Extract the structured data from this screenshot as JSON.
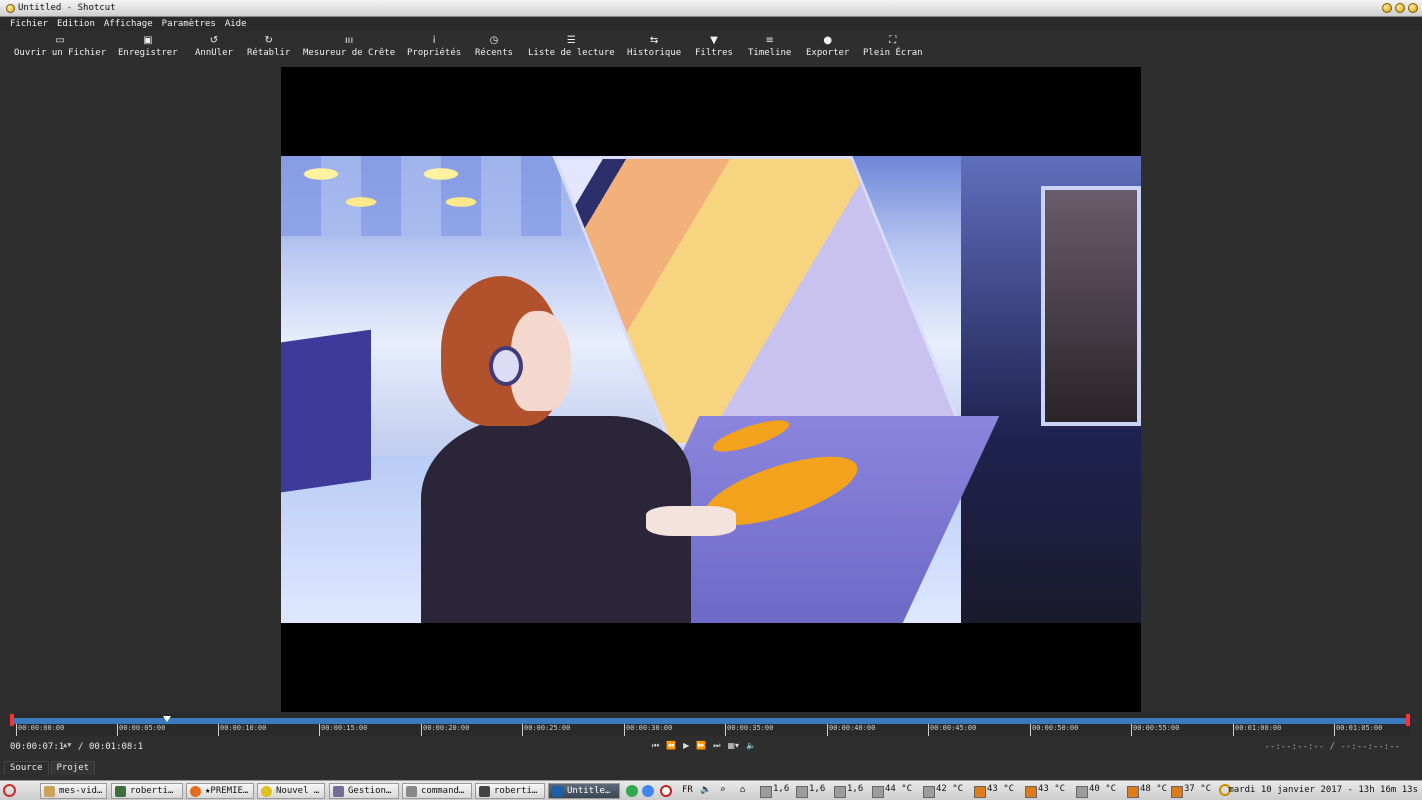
{
  "window": {
    "title": "Untitled - Shotcut"
  },
  "menu": [
    "Fichier",
    "Edition",
    "Affichage",
    "Paramètres",
    "Aide"
  ],
  "toolbar": [
    {
      "label": "Ouvrir un Fichier",
      "icon": "folder-icon"
    },
    {
      "label": "Enregistrer",
      "icon": "save-icon"
    },
    {
      "label": "AnnUler",
      "icon": "undo-icon"
    },
    {
      "label": "Rétablir",
      "icon": "redo-icon"
    },
    {
      "label": "Mesureur de Crête",
      "icon": "peak-meter-icon"
    },
    {
      "label": "Propriétés",
      "icon": "info-icon"
    },
    {
      "label": "Récents",
      "icon": "clock-icon"
    },
    {
      "label": "Liste de lecture",
      "icon": "list-icon"
    },
    {
      "label": "Historique",
      "icon": "history-icon"
    },
    {
      "label": "Filtres",
      "icon": "filter-icon"
    },
    {
      "label": "Timeline",
      "icon": "timeline-icon"
    },
    {
      "label": "Exporter",
      "icon": "export-icon"
    },
    {
      "label": "Plein Écran",
      "icon": "fullscreen-icon"
    }
  ],
  "ruler": {
    "ticks": [
      "00:00:00:00",
      "00:00:05:00",
      "00:00:10:00",
      "00:00:15:00",
      "00:00:20:00",
      "00:00:25:00",
      "00:00:30:00",
      "00:00:35:00",
      "00:00:40:00",
      "00:00:45:00",
      "00:00:50:00",
      "00:00:55:00",
      "00:01:00:00",
      "00:01:05:00"
    ],
    "accent": "#3a7bbf"
  },
  "transport": {
    "position": "00:00:07:1",
    "separator": "/",
    "duration": "00:01:08:1",
    "in_out": "--:--:--:-- / --:--:--:--"
  },
  "tabs": [
    "Source",
    "Projet"
  ],
  "taskbar": {
    "tasks": [
      "mes-vid…",
      "roberti…",
      "★PREMIE…",
      "Nouvel …",
      "Gestion…",
      "command…",
      "roberti…",
      "Untitle…"
    ],
    "lang": "FR",
    "sensors": [
      "1,6",
      "1,6",
      "1,6",
      "44 °C",
      "42 °C",
      "43 °C",
      "43 °C",
      "40 °C",
      "48 °C",
      "37 °C"
    ],
    "clock": "mardi 10 janvier 2017 - 13h 16m 13s"
  }
}
